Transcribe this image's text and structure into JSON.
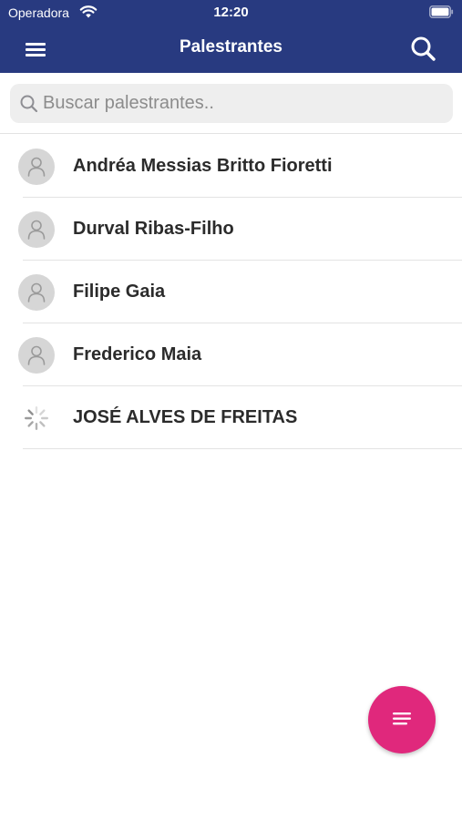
{
  "status_bar": {
    "carrier": "Operadora",
    "time": "12:20",
    "icons": [
      "wifi-icon",
      "battery-icon"
    ]
  },
  "navbar": {
    "title": "Palestrantes",
    "left_icon": "menu-icon",
    "right_icon": "search-icon"
  },
  "search": {
    "placeholder": "Buscar palestrantes..",
    "value": "",
    "icon": "search-icon"
  },
  "speakers": [
    {
      "name": "Andréa Messias Britto Fioretti",
      "avatar": "person-placeholder-icon"
    },
    {
      "name": "Durval Ribas-Filho",
      "avatar": "person-placeholder-icon"
    },
    {
      "name": "Filipe Gaia",
      "avatar": "person-placeholder-icon"
    },
    {
      "name": "Frederico Maia",
      "avatar": "person-placeholder-icon"
    },
    {
      "name": "JOSÉ ALVES DE FREITAS",
      "avatar": "loading-spinner-icon"
    }
  ],
  "fab": {
    "icon": "filter-lines-icon"
  },
  "colors": {
    "primary": "#283a80",
    "accent": "#e0287c",
    "search_background": "#eeeeee",
    "avatar_placeholder": "#d6d6d6",
    "text": "#2b2b2b"
  }
}
